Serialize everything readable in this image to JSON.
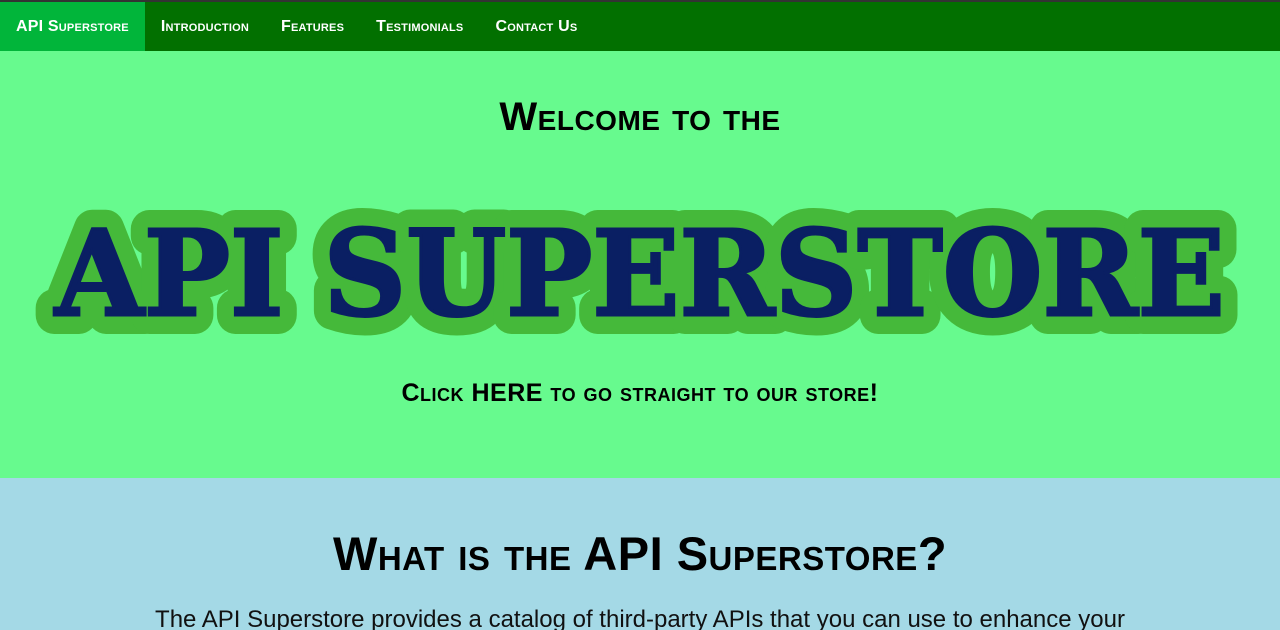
{
  "nav": {
    "brand": "API Superstore",
    "items": [
      {
        "label": "Introduction"
      },
      {
        "label": "Features"
      },
      {
        "label": "Testimonials"
      },
      {
        "label": "Contact Us"
      }
    ]
  },
  "hero": {
    "welcome": "Welcome to the",
    "title": "API SUPERSTORE",
    "cta_before": "Click ",
    "cta_link": "HERE",
    "cta_after": " to go straight to our store!"
  },
  "intro": {
    "heading": "What is the API Superstore?",
    "text": "The API Superstore provides a catalog of third-party APIs that you can use to enhance your"
  },
  "colors": {
    "navbar": "#027000",
    "nav_brand": "#01b53a",
    "hero_bg": "#67fa8e",
    "title_fill": "#0a1f63",
    "title_outline": "#45b93a",
    "intro_bg": "#a4d9e6"
  }
}
